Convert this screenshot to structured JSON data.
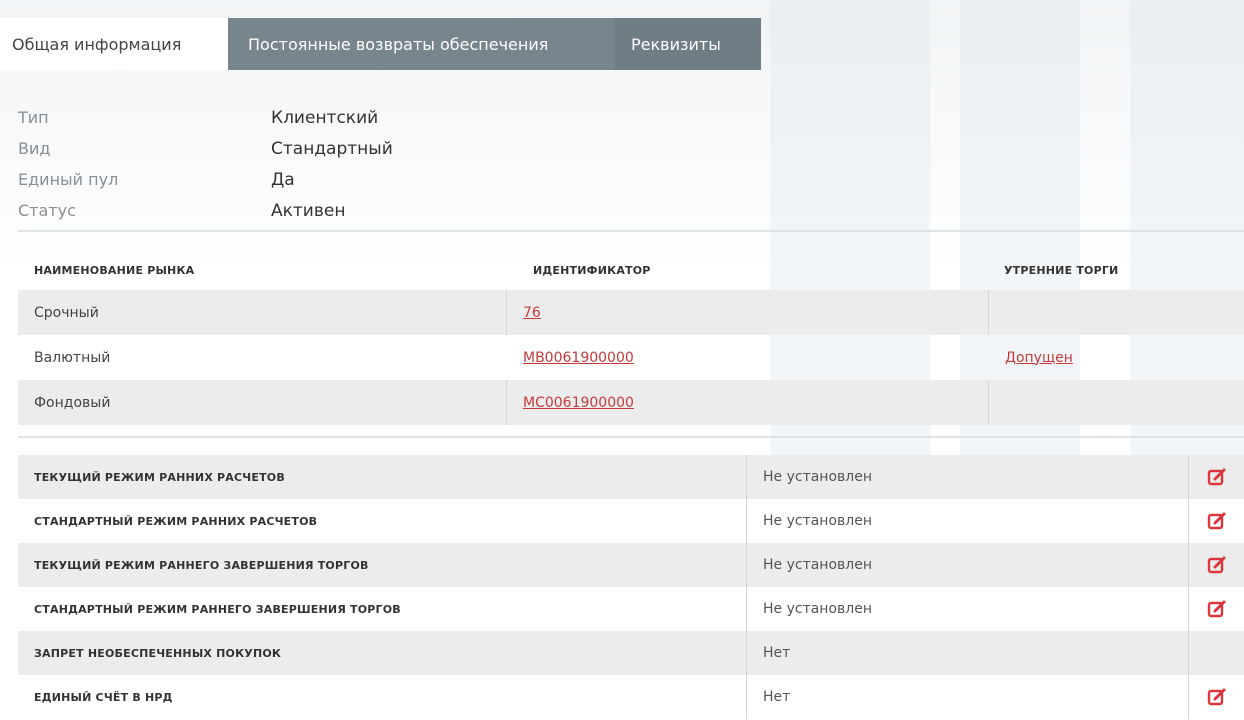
{
  "tabs": [
    {
      "label": "Общая информация",
      "active": true
    },
    {
      "label": "Постоянные возвраты обеспечения",
      "active": false
    },
    {
      "label": "Реквизиты",
      "active": false
    }
  ],
  "info": [
    {
      "label": "Тип",
      "value": "Клиентский"
    },
    {
      "label": "Вид",
      "value": "Стандартный"
    },
    {
      "label": "Единый пул",
      "value": "Да"
    },
    {
      "label": "Статус",
      "value": "Активен"
    }
  ],
  "markets": {
    "headers": [
      "НАИМЕНОВАНИЕ РЫНКА",
      "ИДЕНТИФИКАТОР",
      "УТРЕННИЕ ТОРГИ"
    ],
    "rows": [
      {
        "name": "Срочный",
        "id": "76",
        "morning": ""
      },
      {
        "name": "Валютный",
        "id": "MB0061900000",
        "morning": "Допущен"
      },
      {
        "name": "Фондовый",
        "id": "MC0061900000",
        "morning": ""
      }
    ]
  },
  "settings": [
    {
      "label": "ТЕКУЩИЙ РЕЖИМ РАННИХ РАСЧЕТОВ",
      "value": "Не установлен",
      "editable": true
    },
    {
      "label": "СТАНДАРТНЫЙ РЕЖИМ РАННИХ РАСЧЕТОВ",
      "value": "Не установлен",
      "editable": true
    },
    {
      "label": "ТЕКУЩИЙ РЕЖИМ РАННЕГО ЗАВЕРШЕНИЯ ТОРГОВ",
      "value": "Не установлен",
      "editable": true
    },
    {
      "label": "СТАНДАРТНЫЙ РЕЖИМ РАННЕГО ЗАВЕРШЕНИЯ ТОРГОВ",
      "value": "Не установлен",
      "editable": true
    },
    {
      "label": "ЗАПРЕТ НЕОБЕСПЕЧЕННЫХ ПОКУПОК",
      "value": "Нет",
      "editable": false
    },
    {
      "label": "ЕДИНЫЙ СЧЁТ В НРД",
      "value": "Нет",
      "editable": true
    }
  ],
  "colors": {
    "tab_bg": "#77858d",
    "link": "#c23b3b",
    "edit_icon": "#d9363e",
    "row_alt": "#ececec"
  },
  "icons": {
    "edit": "edit-icon"
  }
}
